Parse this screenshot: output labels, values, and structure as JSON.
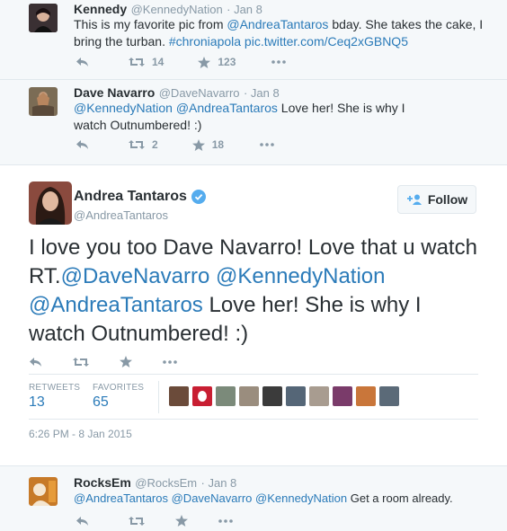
{
  "tweets": {
    "kennedy": {
      "name": "Kennedy",
      "handle": "@KennedyNation",
      "time": "· Jan 8",
      "text_1": "This is my favorite pic from ",
      "mention_1": "@AndreaTantaros",
      "text_2": " bday. She takes the cake, I bring the turban. ",
      "hashtag": "#chroniapola",
      "media_link": " pic.twitter.com/Ceq2xGBNQ5",
      "retweets": "14",
      "favorites": "123"
    },
    "navarro": {
      "name": "Dave Navarro",
      "handle": "@DaveNavarro",
      "time": "· Jan 8",
      "mention_1": "@KennedyNation",
      "mention_2": "@AndreaTantaros",
      "text": " Love her! She is why I watch Outnumbered! :)",
      "retweets": "2",
      "favorites": "18"
    },
    "main": {
      "name": "Andrea Tantaros",
      "handle": "@AndreaTantaros",
      "follow_label": "Follow",
      "text_1": "I love you too Dave Navarro! Love that u watch RT.",
      "mention_1": "@DaveNavarro",
      "mention_2": "@KennedyNation",
      "mention_3": "@AndreaTantaros",
      "text_2": "  Love her! She is why I watch Outnumbered! :)",
      "retweets_label": "RETWEETS",
      "retweets": "13",
      "favorites_label": "FAVORITES",
      "favorites": "65",
      "timestamp": "6:26 PM - 8 Jan 2015"
    },
    "rocksem": {
      "name": "RocksEm",
      "handle": "@RocksEm",
      "time": "· Jan 8",
      "mention_1": "@AndreaTantaros",
      "mention_2": "@DaveNavarro",
      "mention_3": "@KennedyNation",
      "text": " Get a room already."
    }
  },
  "colors": {
    "link": "#2b7bb9",
    "text": "#292f33",
    "muted": "#8899a6",
    "verified": "#55acee",
    "reply_bg": "#f5f8fa"
  },
  "icons": [
    "reply-icon",
    "retweet-icon",
    "favorite-icon",
    "more-icon",
    "verified-icon",
    "follow-person-icon"
  ]
}
